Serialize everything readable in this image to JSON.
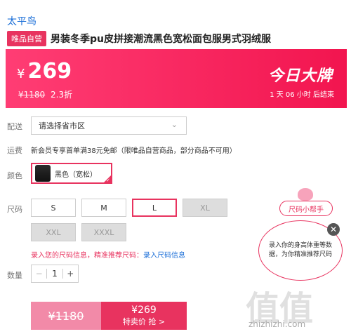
{
  "brand": "太平鸟",
  "badge": "唯品自营",
  "title": "男装冬季pu皮拼接潮流黑色宽松面包服男式羽绒服",
  "price": {
    "currency": "¥",
    "now": "269",
    "original": "¥1180",
    "discount": "2.3折"
  },
  "banner": {
    "today": "今日大牌",
    "countdown": "1 天 06 小时 后结束"
  },
  "labels": {
    "ship_to": "配送",
    "freight": "运费",
    "color": "颜色",
    "size": "尺码",
    "qty": "数量"
  },
  "ship_select": {
    "placeholder": "请选择省市区"
  },
  "freight_text": "新会员专享首单满38元免邮（限唯品自营商品，部分商品不可用）",
  "color_option": "黑色（宽松）",
  "sizes": [
    {
      "label": "S",
      "state": "normal"
    },
    {
      "label": "M",
      "state": "normal"
    },
    {
      "label": "L",
      "state": "selected"
    },
    {
      "label": "XL",
      "state": "disabled"
    },
    {
      "label": "XXL",
      "state": "disabled"
    },
    {
      "label": "XXXL",
      "state": "disabled"
    }
  ],
  "size_hint": {
    "a": "录入您的尺码信息，精准推荐尺码：",
    "b": "录入尺码信息"
  },
  "quantity": "1",
  "buy": {
    "original": "¥1180",
    "now": "¥269",
    "action": "特卖价 抢 >"
  },
  "helper": {
    "tag": "尺码小帮手",
    "bubble": "录入你的身高体重等数据，为你精准推荐尺码"
  },
  "watermark": {
    "text": "值值值",
    "url": "zhizhizhi.com"
  }
}
